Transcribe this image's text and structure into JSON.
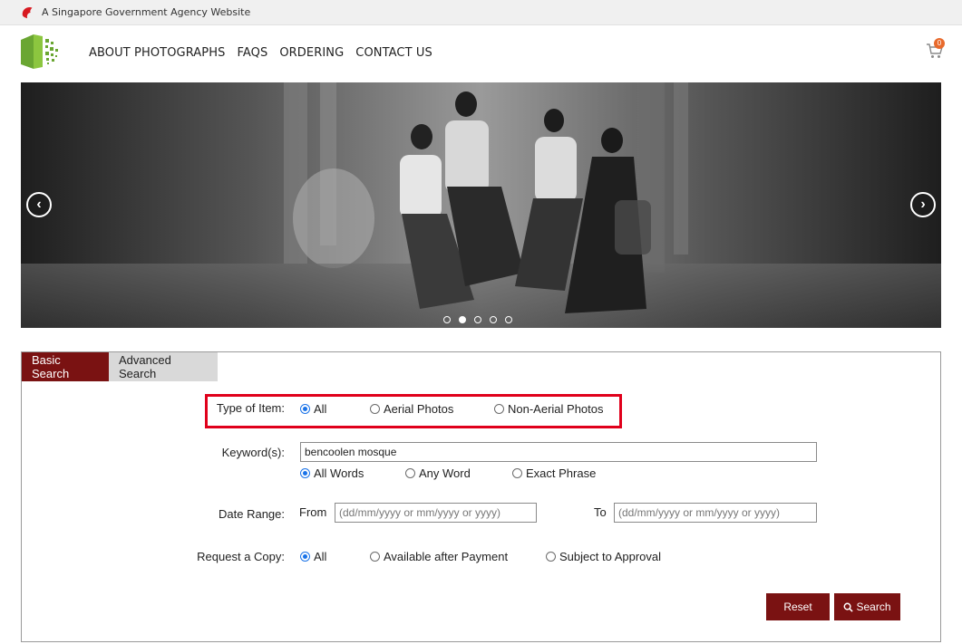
{
  "gov_banner": {
    "text": "A Singapore Government Agency Website"
  },
  "nav": {
    "items": [
      {
        "label": "ABOUT PHOTOGRAPHS"
      },
      {
        "label": "FAQS"
      },
      {
        "label": "ORDERING"
      },
      {
        "label": "CONTACT US"
      }
    ]
  },
  "cart": {
    "count": "0",
    "icon": "cart-icon"
  },
  "carousel": {
    "slides": 5,
    "active_slide": 2,
    "prev_icon": "chevron-left-circle-icon",
    "next_icon": "chevron-right-circle-icon",
    "prev_glyph": "‹",
    "next_glyph": "›"
  },
  "search": {
    "tabs": [
      {
        "label": "Basic Search",
        "active": true
      },
      {
        "label": "Advanced Search",
        "active": false
      }
    ],
    "type_of_item": {
      "label": "Type of Item:",
      "options": [
        "All",
        "Aerial Photos",
        "Non-Aerial Photos"
      ],
      "selected": "All"
    },
    "keyword": {
      "label": "Keyword(s):",
      "value": "bencoolen mosque",
      "match_options": [
        "All Words",
        "Any Word",
        "Exact Phrase"
      ],
      "selected": "All Words"
    },
    "date_range": {
      "label": "Date Range:",
      "from_label": "From",
      "to_label": "To",
      "from_placeholder": "(dd/mm/yyyy or mm/yyyy or yyyy)",
      "to_placeholder": "(dd/mm/yyyy or mm/yyyy or yyyy)"
    },
    "request_copy": {
      "label": "Request a Copy:",
      "options": [
        "All",
        "Available after Payment",
        "Subject to Approval"
      ],
      "selected": "All"
    },
    "reset_label": "Reset",
    "search_label": "Search"
  },
  "colors": {
    "brand_red": "#7a1212",
    "highlight_red": "#e0001b",
    "radio_blue": "#1a73e8",
    "logo_green": "#6aa632"
  }
}
